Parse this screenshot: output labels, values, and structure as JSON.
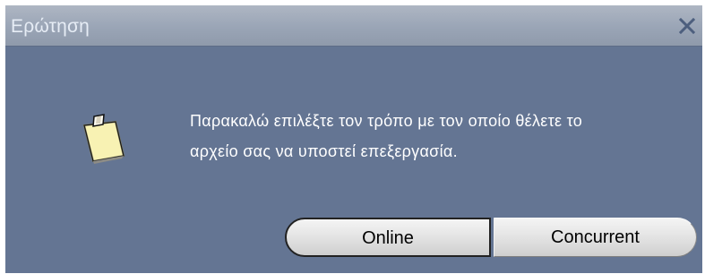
{
  "window": {
    "title": "Ερώτηση"
  },
  "dialog": {
    "message_lines": [
      "Παρακαλώ επιλέξτε τον τρόπο με τον οποίο θέλετε το",
      "αρχείο σας να υποστεί επεξεργασία."
    ],
    "icon": "note-icon",
    "close_icon": "close-icon"
  },
  "buttons": {
    "online": "Online",
    "concurrent": "Concurrent"
  },
  "colors": {
    "dialog_background": "#647593",
    "titlebar": "#9aa5b6",
    "text": "#ffffff",
    "button_face": "#e5e5e5"
  }
}
